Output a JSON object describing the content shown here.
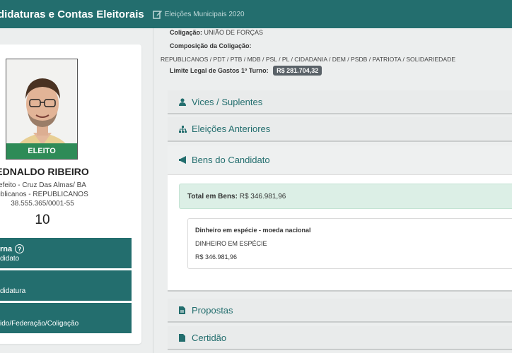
{
  "header": {
    "app_title": "didaturas e Contas Eleitorais",
    "subtitle": "Eleições Municipais 2020",
    "icon": "edit-icon"
  },
  "candidate": {
    "status_badge": "ELEITO",
    "name": "EDNALDO RIBEIRO",
    "office_city": "efeito - Cruz Das Almas/ BA",
    "party": "ublicanos - REPUBLICANOS",
    "cnpj": "38.555.365/0001-55",
    "number": "10"
  },
  "side_menu": [
    {
      "line1": "rna",
      "line2": "didato",
      "icon": "help-circle-icon"
    },
    {
      "line1": "",
      "line2": "didatura"
    },
    {
      "line1": "",
      "line2": "ido/Federação/Coligação"
    }
  ],
  "coalition": {
    "coligacao_label": "Coligação:",
    "coligacao_value": "UNIÃO DE FORÇAS",
    "composicao_label": "Composição da Coligação:",
    "composicao_value": "REPUBLICANOS / PDT / PTB / MDB / PSL / PL / CIDADANIA / DEM / PSDB / PATRIOTA / SOLIDARIEDADE",
    "limite_label": "Limite Legal de Gastos 1º Turno:",
    "limite_value": "R$ 281.704,32"
  },
  "accordion": {
    "vices": {
      "label": "Vices / Suplentes",
      "icon": "user-icon"
    },
    "eleicoes": {
      "label": "Eleições Anteriores",
      "icon": "sitemap-icon"
    },
    "bens": {
      "label": "Bens do Candidato",
      "icon": "megaphone-icon"
    },
    "propostas": {
      "label": "Propostas",
      "icon": "file-icon"
    },
    "certidao": {
      "label": "Certidão",
      "icon": "document-icon"
    }
  },
  "bens": {
    "total_label": "Total em Bens:",
    "total_value": "R$ 346.981,96",
    "items": [
      {
        "title": "Dinheiro em espécie - moeda nacional",
        "description": "DINHEIRO EM ESPÉCIE",
        "value": "R$ 346.981,96"
      }
    ]
  },
  "colors": {
    "brand": "#236e6e",
    "eleito": "#2e8b57"
  }
}
